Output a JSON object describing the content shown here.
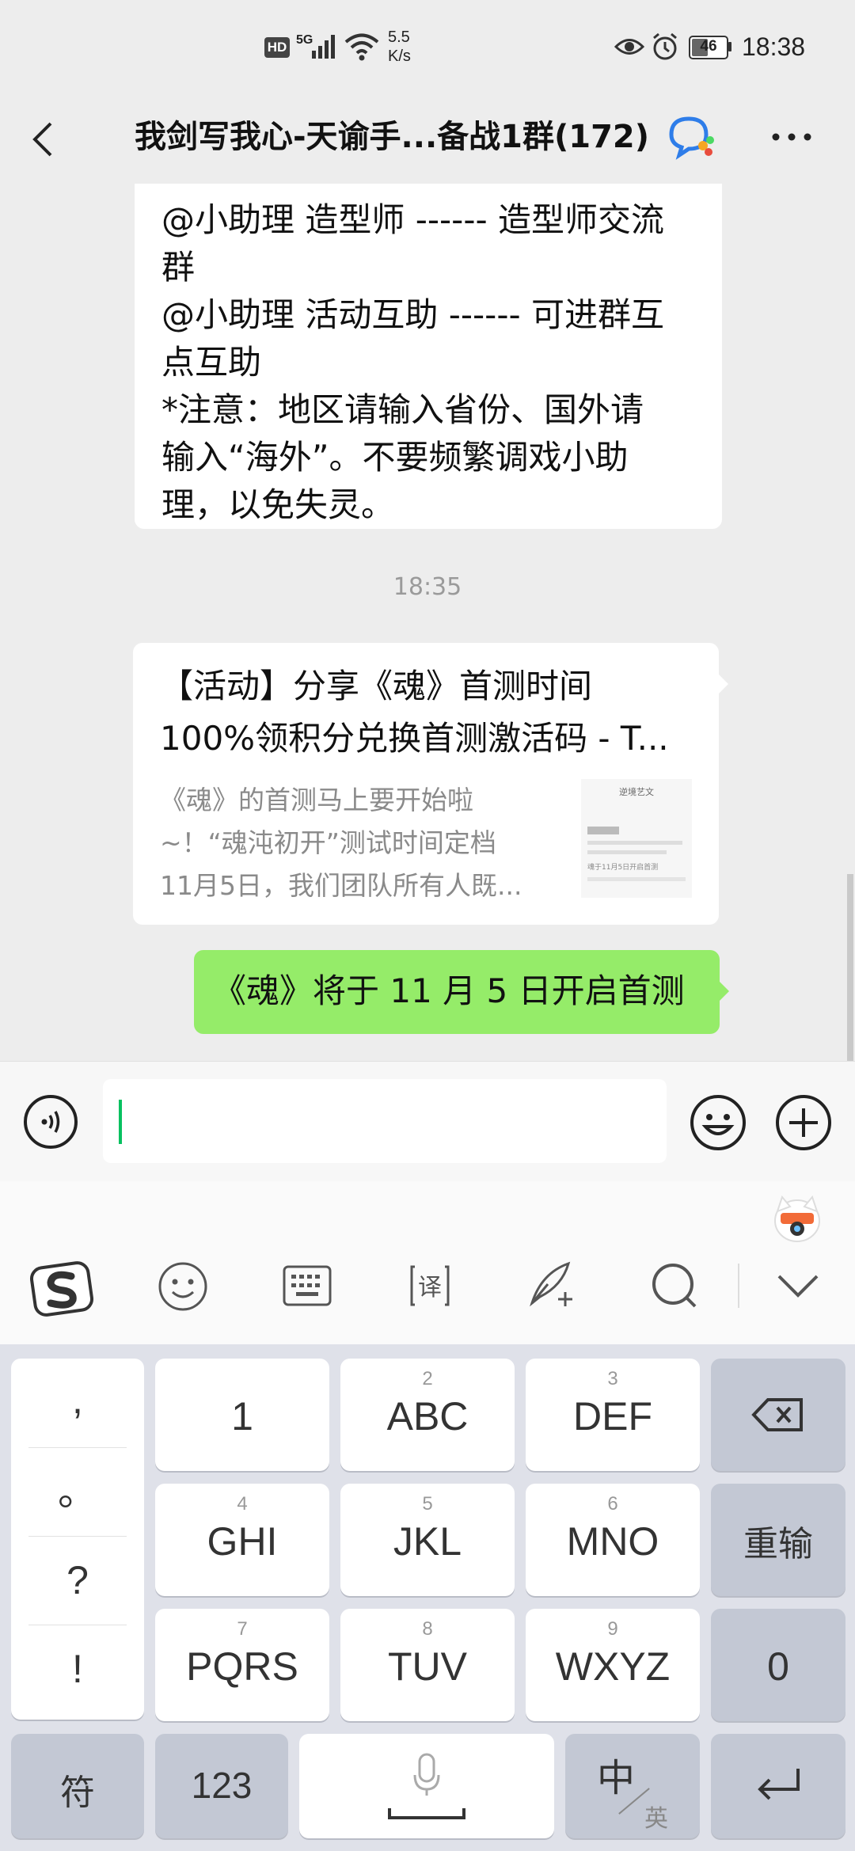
{
  "status_bar": {
    "hd": "HD",
    "network": "5G",
    "speed_value": "5.5",
    "speed_unit": "K/s",
    "battery": "46",
    "time": "18:38"
  },
  "title_bar": {
    "title": "我剑写我心-天谕手...备战1群(172)"
  },
  "messages": {
    "text_lines": [
      "@小助理 造型师 ------ 造型师交流",
      "群",
      "@小助理 活动互助 ------ 可进群互",
      "点互助",
      "*注意：地区请输入省份、国外请",
      "输入“海外”。不要频繁调戏小助",
      "理，以免失灵。"
    ],
    "time_divider": "18:35",
    "link_card": {
      "title_line1": "【活动】分享《魂》首测时间",
      "title_line2": "100%领积分兑换首测激活码 - T...",
      "desc_lines": [
        "《魂》的首测马上要开始啦",
        "~！“魂沌初开”测试时间定档",
        "11月5日，我们团队所有人既..."
      ],
      "thumb_title": "逆境艺文",
      "thumb_line": "魂于11月5日开启首测"
    },
    "sent_text": "《魂》将于 11 月 5 日开启首测"
  },
  "input": {
    "value": ""
  },
  "keyboard": {
    "punct": [
      ",",
      "。",
      "?",
      "!"
    ],
    "keys": [
      {
        "num": "",
        "label": "1"
      },
      {
        "num": "2",
        "label": "ABC"
      },
      {
        "num": "3",
        "label": "DEF"
      },
      {
        "num": "4",
        "label": "GHI"
      },
      {
        "num": "5",
        "label": "JKL"
      },
      {
        "num": "6",
        "label": "MNO"
      },
      {
        "num": "7",
        "label": "PQRS"
      },
      {
        "num": "8",
        "label": "TUV"
      },
      {
        "num": "9",
        "label": "WXYZ"
      }
    ],
    "retype": "重输",
    "zero": "0",
    "symbol": "符",
    "num123": "123",
    "zh": "中",
    "en": "英"
  },
  "colors": {
    "accent_green": "#95ec69",
    "cursor": "#07c160",
    "keyboard_bg": "#dfe1e9"
  },
  "icons": [
    "back-arrow-icon",
    "more-icon",
    "chat-bubbles-icon",
    "voice-icon",
    "emoji-icon",
    "plus-icon",
    "sogou-logo-icon",
    "smile-icon",
    "keyboard-icon",
    "translate-icon",
    "handwrite-icon",
    "search-icon",
    "collapse-chevron-icon",
    "backspace-icon",
    "microphone-icon",
    "enter-icon"
  ]
}
